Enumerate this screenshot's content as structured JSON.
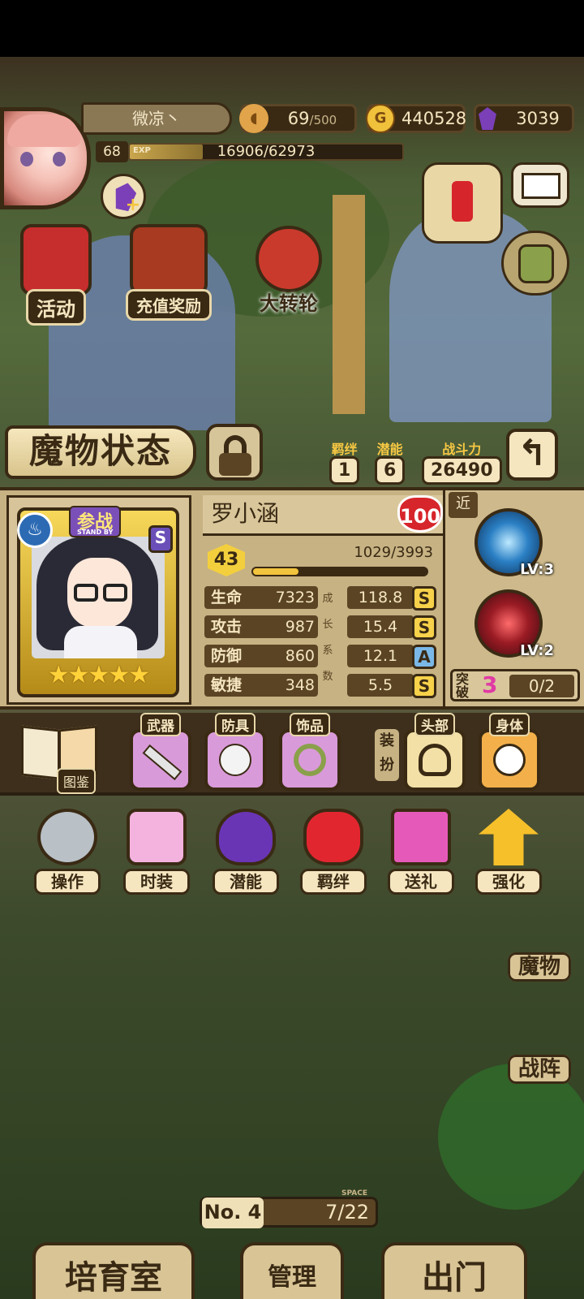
{
  "player": {
    "name": "微凉丶",
    "level": "68",
    "exp_label": "EXP",
    "exp_text": "16906/62973",
    "exp_ratio": 0.268
  },
  "resources": {
    "stamina": "69",
    "stamina_max": "/500",
    "gold_icon": "G",
    "gold": "440528",
    "gems": "3039"
  },
  "menu": {
    "events": "活动",
    "recharge_rewards": "充值奖励",
    "wheel": "大转轮"
  },
  "monster_panel": {
    "title": "魔物状态",
    "bond_label": "羁绊",
    "bond_value": "1",
    "potential_label": "潜能",
    "potential_value": "6",
    "power_label": "战斗力",
    "power_value": "26490",
    "back_glyph": "↰"
  },
  "monster": {
    "name": "罗小涵",
    "affection": "100",
    "standby_label": "参战",
    "standby_sub": "STAND BY",
    "rank": "S",
    "element_glyph": "♨",
    "stars": "★★★★★",
    "level": "43",
    "exp_text": "1029/3993",
    "exp_ratio": 0.258,
    "growth_label": [
      "成",
      "长",
      "系",
      "数"
    ],
    "stats": [
      {
        "label": "生命",
        "value": "7323",
        "growth": "118.8",
        "grade": "S"
      },
      {
        "label": "攻击",
        "value": "987",
        "growth": "15.4",
        "grade": "S"
      },
      {
        "label": "防御",
        "value": "860",
        "growth": "12.1",
        "grade": "A"
      },
      {
        "label": "敏捷",
        "value": "348",
        "growth": "5.5",
        "grade": "S"
      }
    ],
    "range": "近",
    "skills": [
      {
        "level": "LV:3"
      },
      {
        "level": "LV:2"
      }
    ],
    "breakthrough_label": "突破",
    "breakthrough_value": "3",
    "breakthrough_progress": "0/2"
  },
  "equipment": {
    "codex": "图鉴",
    "weapon": "武器",
    "armor": "防具",
    "accessory": "饰品",
    "dress_up": "装扮",
    "head": "头部",
    "body": "身体"
  },
  "actions": [
    "操作",
    "时装",
    "潜能",
    "羁绊",
    "送礼",
    "强化"
  ],
  "right_nav": {
    "monsters": "魔物",
    "formation": "战阵"
  },
  "bottom": {
    "no_label": "No. 4",
    "space_label": "SPACE",
    "space_count": "7/22",
    "nursery": "培育室",
    "manage": "管理",
    "expedition": "出门"
  },
  "colors": {
    "accent_gold": "#f3cf3d",
    "panel_bg": "#c7b283",
    "dark_brown": "#3a2a14",
    "grade_s": "#f7d24a",
    "grade_a": "#7ab8e8"
  }
}
